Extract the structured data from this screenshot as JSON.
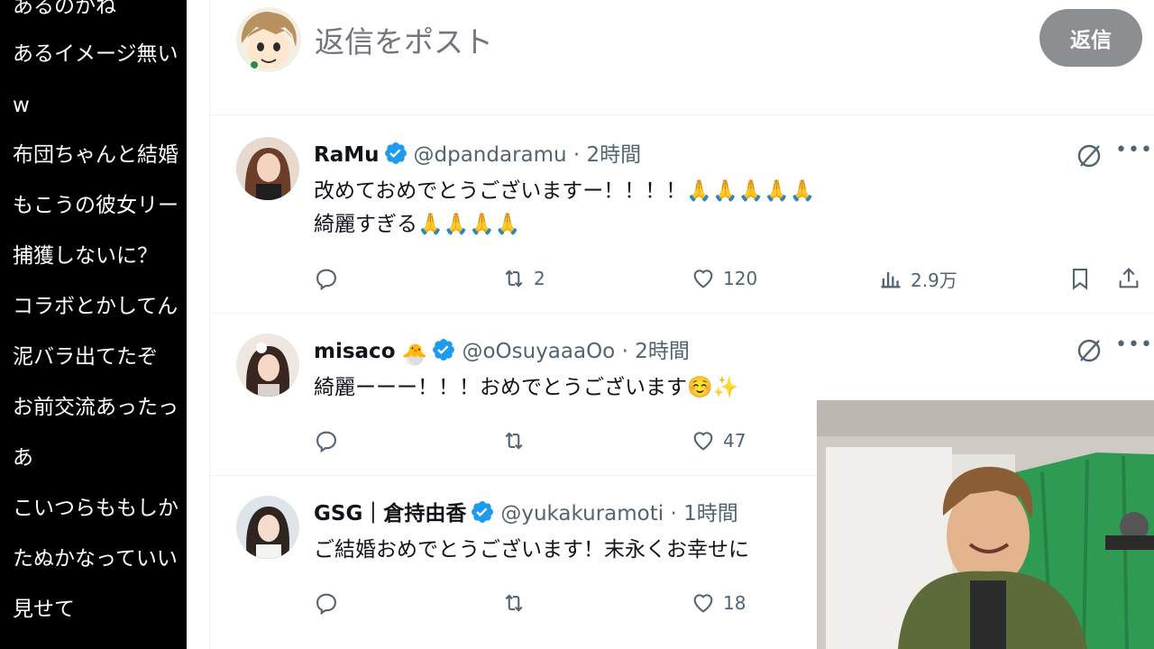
{
  "comments": [
    {
      "text": "あるのかね"
    },
    {
      "text": "あるイメージ無い"
    },
    {
      "text": "w"
    },
    {
      "text": "布団ちゃんと結婚"
    },
    {
      "text": "もこうの彼女リー"
    },
    {
      "text": "捕獲しないに？"
    },
    {
      "text": "コラボとかしてん"
    },
    {
      "text": "泥バラ出てたぞ"
    },
    {
      "text": "お前交流あったっ"
    },
    {
      "text": "あ"
    },
    {
      "text": "こいつらももしか"
    },
    {
      "text": "たぬかなっていい"
    },
    {
      "text": "見せて"
    }
  ],
  "reply": {
    "placeholder": "返信をポスト",
    "button": "返信"
  },
  "tweets": [
    {
      "name": "RaMu",
      "name_emoji": "",
      "handle": "@dpandaramu",
      "time": "2時間",
      "lines": [
        "改めておめでとうございますー！！！！🙏🙏🙏🙏🙏",
        "綺麗すぎる🙏🙏🙏🙏"
      ],
      "replies": "",
      "retweets": "2",
      "likes": "120",
      "views": "2.9万"
    },
    {
      "name": "misaco",
      "name_emoji": "🐣",
      "handle": "@oOsuyaaaOo",
      "time": "2時間",
      "lines": [
        "綺麗ーーー！！！おめでとうございます☺️✨"
      ],
      "replies": "",
      "retweets": "",
      "likes": "47",
      "views": ""
    },
    {
      "name": "GSG｜倉持由香",
      "name_emoji": "",
      "handle": "@yukakuramoti",
      "time": "1時間",
      "lines": [
        "ご結婚おめでとうございます！末永くお幸せに"
      ],
      "replies": "",
      "retweets": "",
      "likes": "18",
      "views": ""
    }
  ],
  "dot": "·",
  "colors": {
    "verified": "#1d9bf0",
    "button": "#8b8f92"
  }
}
